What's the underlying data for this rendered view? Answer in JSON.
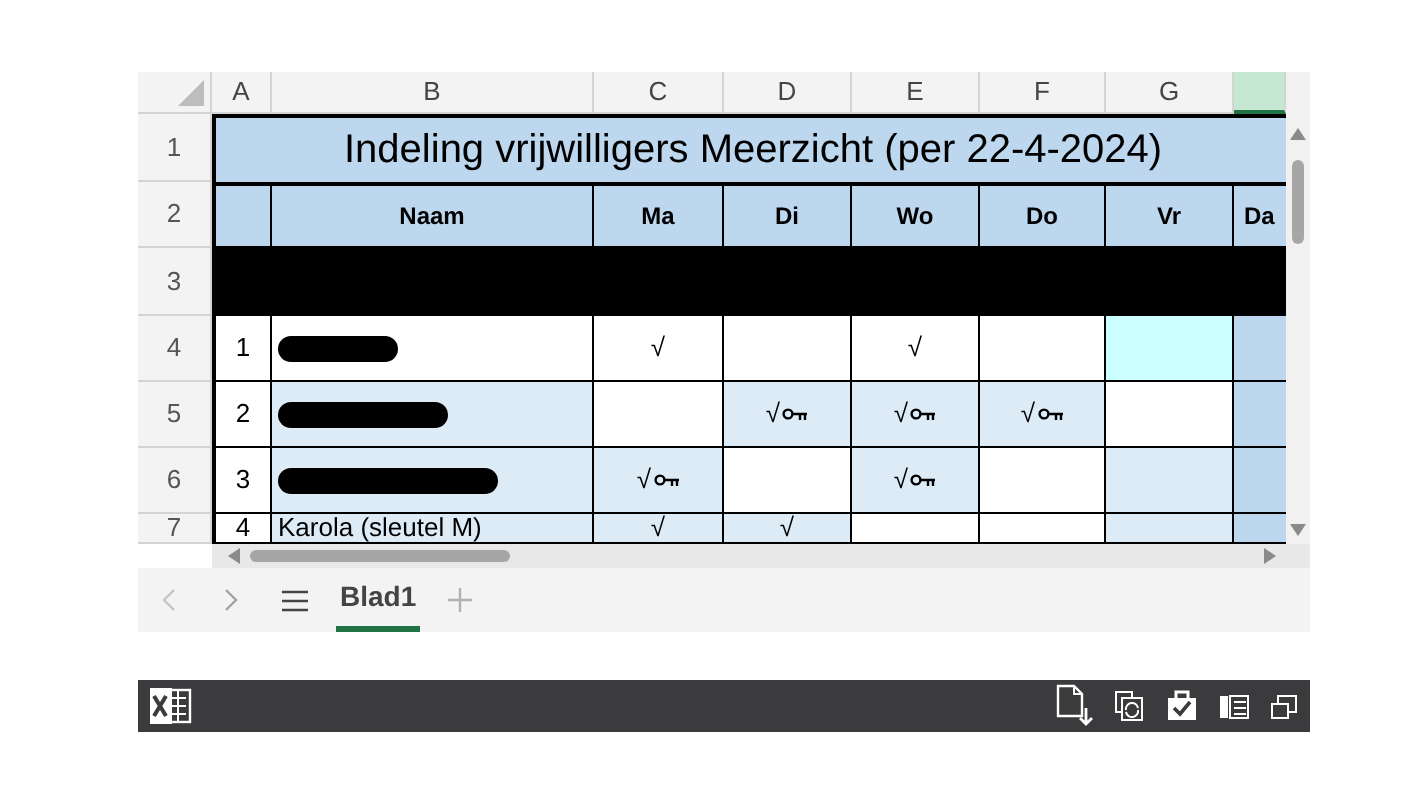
{
  "column_headers": [
    {
      "label": "A",
      "selected": false
    },
    {
      "label": "B",
      "selected": false
    },
    {
      "label": "C",
      "selected": false
    },
    {
      "label": "D",
      "selected": false
    },
    {
      "label": "E",
      "selected": false
    },
    {
      "label": "F",
      "selected": false
    },
    {
      "label": "G",
      "selected": false
    },
    {
      "selected": true
    }
  ],
  "row_headers": [
    "1",
    "2",
    "3",
    "4",
    "5",
    "6",
    "7"
  ],
  "title": "Indeling vrijwilligers Meerzicht (per 22-4-2024)",
  "table_headers": [
    "Naam",
    "Ma",
    "Di",
    "Wo",
    "Do",
    "Vr",
    "Da"
  ],
  "rows": [
    {
      "number": "1",
      "redacted": true,
      "color": "#ffffff",
      "cells": [
        {
          "text": "√",
          "key": false,
          "color": "#ffffff"
        },
        {
          "key": false,
          "color": "#ffffff"
        },
        {
          "text": "√",
          "key": false,
          "color": "#ffffff"
        },
        {
          "key": false,
          "color": "#ffffff"
        },
        {
          "key": false,
          "color": "#ccffff"
        },
        {
          "key": false,
          "color": "#bdd7ee"
        }
      ]
    },
    {
      "number": "2",
      "redacted": true,
      "color": "#ddebf7",
      "cells": [
        {
          "key": false,
          "color": "#ffffff"
        },
        {
          "text": "√",
          "key": true,
          "color": "#ddebf7"
        },
        {
          "text": "√",
          "key": true,
          "color": "#ddebf7"
        },
        {
          "text": "√",
          "key": true,
          "color": "#ddebf7"
        },
        {
          "key": false,
          "color": "#ffffff"
        },
        {
          "key": false,
          "color": "#bdd7ee"
        }
      ]
    },
    {
      "number": "3",
      "redacted": true,
      "color": "#ddebf7",
      "cells": [
        {
          "text": "√",
          "key": true,
          "color": "#ddebf7"
        },
        {
          "key": false,
          "color": "#ffffff"
        },
        {
          "text": "√",
          "key": true,
          "color": "#ddebf7"
        },
        {
          "key": false,
          "color": "#ffffff"
        },
        {
          "key": false,
          "color": "#ddebf7"
        },
        {
          "key": false,
          "color": "#bdd7ee"
        }
      ]
    },
    {
      "number": "4",
      "name": "Karola (sleutel M)",
      "redacted": false,
      "color": "#ddebf7",
      "cells": [
        {
          "text": "√",
          "key": false,
          "color": "#ddebf7"
        },
        {
          "text": "√",
          "key": false,
          "color": "#ddebf7"
        },
        {
          "key": false,
          "color": "#ffffff"
        },
        {
          "key": false,
          "color": "#ffffff"
        },
        {
          "key": false,
          "color": "#ddebf7"
        },
        {
          "key": false,
          "color": "#bdd7ee"
        }
      ]
    }
  ],
  "sheet_tabs": [
    {
      "label": "Blad1",
      "selected": true
    }
  ]
}
